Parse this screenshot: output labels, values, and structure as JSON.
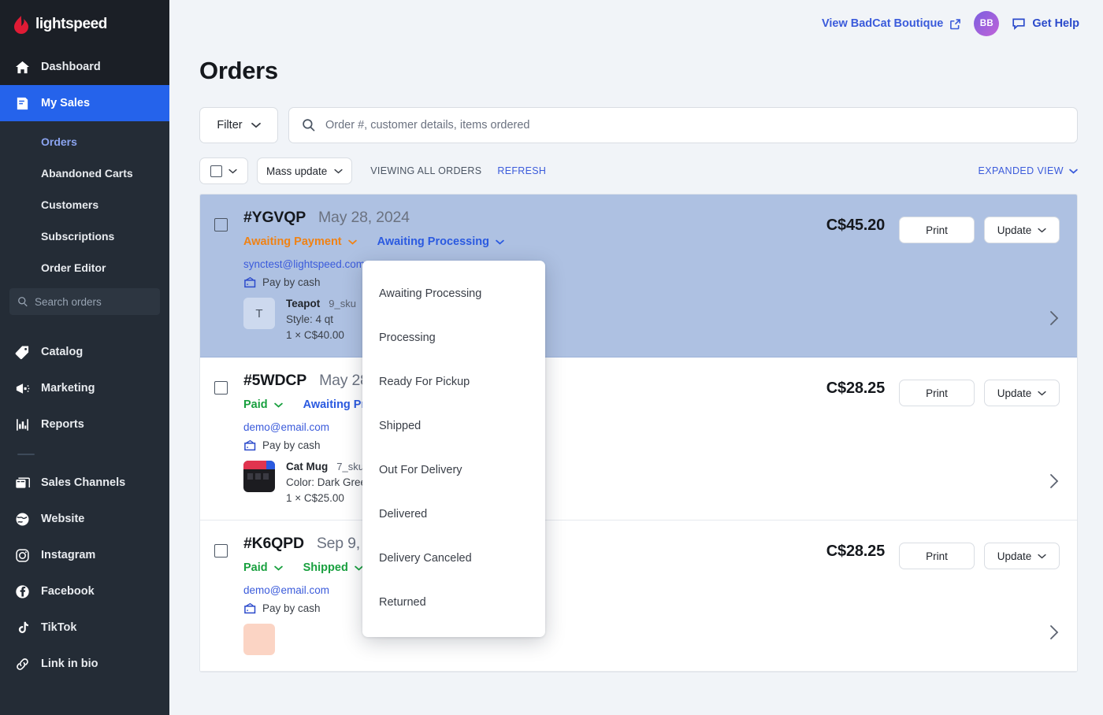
{
  "brand": {
    "name": "lightspeed",
    "logo_icon": "lightspeed-flame-icon",
    "accent_blue": "#2563eb",
    "page_bg": "#f1f4f8",
    "sidebar_bg": "#242c36",
    "sidebar_top_bg": "#1b1f26",
    "selected_row_bg": "#aec1e2"
  },
  "topbar": {
    "view_store_label": "View BadCat Boutique",
    "external_link_icon": "external-link-icon",
    "avatar_initials": "BB",
    "get_help_label": "Get Help",
    "chat_icon": "chat-bubble-icon"
  },
  "sidebar": {
    "primary": [
      {
        "label": "Dashboard",
        "icon": "home-icon",
        "active": false
      },
      {
        "label": "My Sales",
        "icon": "sales-document-icon",
        "active": true
      }
    ],
    "sub_items": [
      {
        "label": "Orders",
        "active": true
      },
      {
        "label": "Abandoned Carts",
        "active": false
      },
      {
        "label": "Customers",
        "active": false
      },
      {
        "label": "Subscriptions",
        "active": false
      },
      {
        "label": "Order Editor",
        "active": false
      }
    ],
    "search": {
      "placeholder": "Search orders",
      "icon": "search-icon",
      "value": ""
    },
    "middle": [
      {
        "label": "Catalog",
        "icon": "tag-icon"
      },
      {
        "label": "Marketing",
        "icon": "megaphone-icon"
      },
      {
        "label": "Reports",
        "icon": "bar-chart-icon"
      }
    ],
    "channels": [
      {
        "label": "Sales Channels",
        "icon": "windows-stack-icon"
      },
      {
        "label": "Website",
        "icon": "globe-icon"
      },
      {
        "label": "Instagram",
        "icon": "instagram-icon"
      },
      {
        "label": "Facebook",
        "icon": "facebook-icon"
      },
      {
        "label": "TikTok",
        "icon": "tiktok-icon"
      },
      {
        "label": "Link in bio",
        "icon": "link-icon"
      }
    ]
  },
  "page": {
    "title": "Orders"
  },
  "toolbar": {
    "filter_label": "Filter",
    "filter_chevron_icon": "chevron-down-icon",
    "search_placeholder": "Order #, customer details, items ordered",
    "search_value": "",
    "search_icon": "search-icon"
  },
  "subbar": {
    "select_all_checkbox_icon": "checkbox-empty-icon",
    "select_all_chevron_icon": "chevron-down-icon",
    "mass_update_label": "Mass update",
    "viewing_text": "VIEWING ALL ORDERS",
    "refresh_label": "REFRESH",
    "expanded_view_label": "EXPANDED VIEW",
    "expanded_view_chevron_icon": "chevron-down-icon"
  },
  "orders": [
    {
      "id": "#YGVQP",
      "date": "May 28, 2024",
      "selected": true,
      "payment_status": {
        "label": "Awaiting Payment",
        "color": "orange"
      },
      "fulfillment_status": {
        "label": "Awaiting Processing",
        "color": "blue"
      },
      "email": "synctest@lightspeed.com",
      "payment_method": "Pay by cash",
      "payment_icon": "wallet-icon",
      "total": "C$45.20",
      "print_label": "Print",
      "update_label": "Update",
      "chevron_icon": "chevron-right-icon",
      "items": [
        {
          "thumb_kind": "letter",
          "thumb_letter": "T",
          "name": "Teapot",
          "sku": "9_sku",
          "option": "Style: 4 qt",
          "qty_price": "1 × C$40.00"
        }
      ]
    },
    {
      "id": "#5WDCP",
      "date": "May 28, 2024",
      "selected": false,
      "payment_status": {
        "label": "Paid",
        "color": "green"
      },
      "fulfillment_status": {
        "label": "Awaiting Processing",
        "color": "blue"
      },
      "email": "demo@email.com",
      "payment_method": "Pay by cash",
      "payment_icon": "wallet-icon",
      "total": "C$28.25",
      "print_label": "Print",
      "update_label": "Update",
      "chevron_icon": "chevron-right-icon",
      "items": [
        {
          "thumb_kind": "mug",
          "thumb_letter": "",
          "name": "Cat Mug",
          "sku": "7_sku",
          "option": "Color: Dark Green",
          "qty_price": "1 × C$25.00"
        }
      ]
    },
    {
      "id": "#K6QPD",
      "date": "Sep 9, 2022",
      "selected": false,
      "payment_status": {
        "label": "Paid",
        "color": "green"
      },
      "fulfillment_status": {
        "label": "Shipped",
        "color": "green"
      },
      "email": "demo@email.com",
      "payment_method": "Pay by cash",
      "payment_icon": "wallet-icon",
      "total": "C$28.25",
      "print_label": "Print",
      "update_label": "Update",
      "chevron_icon": "chevron-right-icon",
      "items": [
        {
          "thumb_kind": "peach",
          "thumb_letter": "",
          "name": "",
          "sku": "",
          "option": "",
          "qty_price": ""
        }
      ]
    }
  ],
  "status_dropdown": {
    "open": true,
    "options": [
      "Awaiting Processing",
      "Processing",
      "Ready For Pickup",
      "Shipped",
      "Out For Delivery",
      "Delivered",
      "Delivery Canceled",
      "Returned"
    ]
  }
}
